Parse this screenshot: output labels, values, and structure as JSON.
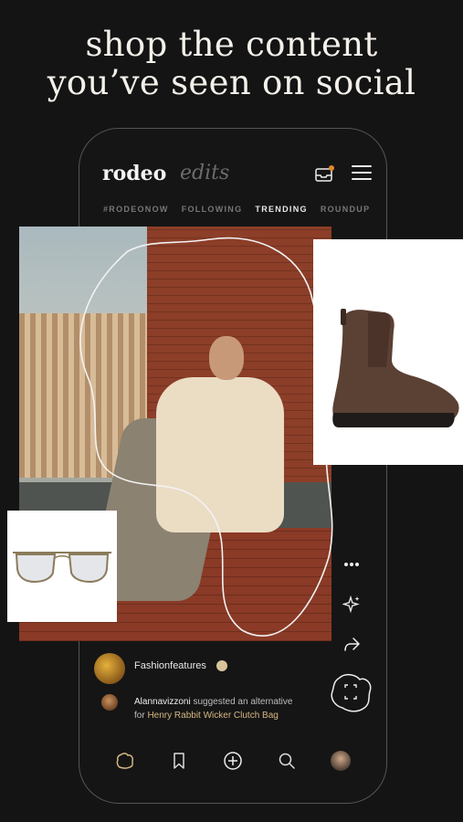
{
  "headline": {
    "line1": "shop the content",
    "line2": "you’ve seen on social"
  },
  "app": {
    "logo": "rodeo",
    "logo_suffix": "edits",
    "tabs": [
      {
        "label": "#RODEONOW",
        "active": false
      },
      {
        "label": "FOLLOWING",
        "active": false
      },
      {
        "label": "TRENDING",
        "active": true
      },
      {
        "label": "ROUNDUP",
        "active": false
      }
    ]
  },
  "post": {
    "username": "Fashionfeatures",
    "suggestion_user": "Alannavizzoni",
    "suggestion_text": "suggested an alternative",
    "suggestion_prefix": "for",
    "suggestion_item": "Henry Rabbit Wicker Clutch Bag"
  },
  "icons": {
    "inbox": "inbox-icon",
    "menu": "hamburger-menu-icon",
    "more": "more-icon",
    "sparkle": "sparkle-icon",
    "share": "share-icon",
    "scan": "scan-icon",
    "home": "home-icon",
    "bookmark": "bookmark-icon",
    "add": "add-icon",
    "search": "search-icon"
  },
  "colors": {
    "background": "#141414",
    "accent": "#d6b680",
    "notification": "#e0892e"
  }
}
